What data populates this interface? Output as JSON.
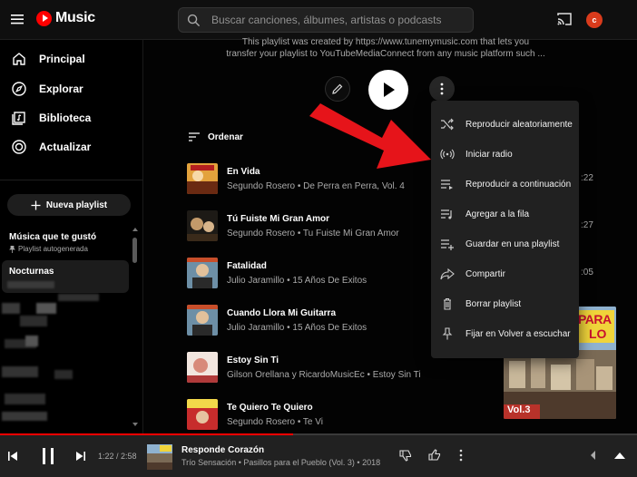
{
  "app": {
    "title": "Music",
    "avatar_letter": "c",
    "accent": "#ff0000"
  },
  "search": {
    "placeholder": "Buscar canciones, álbumes, artistas o podcasts"
  },
  "sidebar": {
    "nav": [
      {
        "label": "Principal",
        "icon": "home-icon"
      },
      {
        "label": "Explorar",
        "icon": "compass-icon"
      },
      {
        "label": "Biblioteca",
        "icon": "library-icon"
      },
      {
        "label": "Actualizar",
        "icon": "upgrade-icon"
      }
    ],
    "new_playlist_label": "Nueva playlist",
    "playlists": [
      {
        "title": "Música que te gustó",
        "subtitle": "Playlist autogenerada"
      },
      {
        "title": "Nocturnas"
      }
    ]
  },
  "playlist": {
    "description_line1": "This playlist was created by https://www.tunemymusic.com that lets you",
    "description_line2": "transfer your playlist to YouTubeMediaConnect from any music platform such ...",
    "sort_label": "Ordenar"
  },
  "tracks": [
    {
      "title": "En Vida",
      "subtitle": "Segundo Rosero • De Perra en Perra, Vol. 4",
      "duration": ":22"
    },
    {
      "title": "Tú Fuiste Mi Gran Amor",
      "subtitle": "Segundo Rosero • Tu Fuiste Mi Gran Amor",
      "duration": ":27"
    },
    {
      "title": "Fatalidad",
      "subtitle": "Julio Jaramillo • 15 Años De Exitos",
      "duration": ":05"
    },
    {
      "title": "Cuando Llora Mi Guitarra",
      "subtitle": "Julio Jaramillo • 15 Años De Exitos",
      "duration": ""
    },
    {
      "title": "Estoy Sin Ti",
      "subtitle": "Gilson Orellana y RicardoMusicEc • Estoy Sin Ti",
      "duration": ""
    },
    {
      "title": "Te Quiero Te Quiero",
      "subtitle": "Segundo Rosero • Te Vi",
      "duration": ""
    }
  ],
  "context_menu": [
    {
      "label": "Reproducir aleatoriamente",
      "icon": "shuffle-icon"
    },
    {
      "label": "Iniciar radio",
      "icon": "radio-icon"
    },
    {
      "label": "Reproducir a continuación",
      "icon": "play-next-icon"
    },
    {
      "label": "Agregar a la fila",
      "icon": "add-to-queue-icon"
    },
    {
      "label": "Guardar en una playlist",
      "icon": "save-to-playlist-icon"
    },
    {
      "label": "Compartir",
      "icon": "share-icon"
    },
    {
      "label": "Borrar playlist",
      "icon": "trash-icon"
    },
    {
      "label": "Fijar en Volver a escuchar",
      "icon": "pin-icon"
    }
  ],
  "cover": {
    "text_top": "PARA",
    "text_mid": "LO",
    "text_bottom": "Vol.3"
  },
  "player": {
    "time": "1:22 / 2:58",
    "progress": 0.46,
    "title": "Responde Corazón",
    "subtitle": "Trío Sensación • Pasillos para el Pueblo (Vol. 3) • 2018"
  }
}
